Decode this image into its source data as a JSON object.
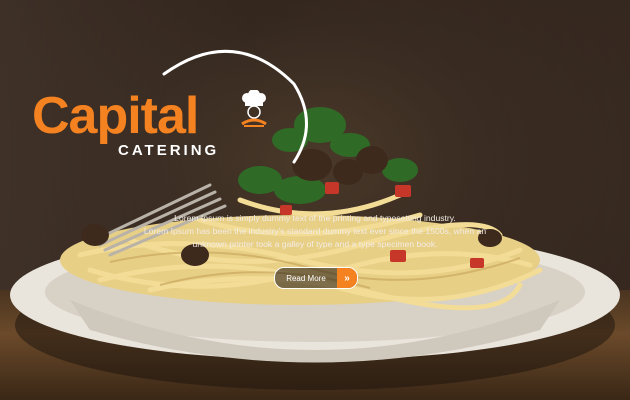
{
  "brand": {
    "name": "Capital",
    "sub": "CATERING",
    "accent": "#f58220",
    "chef_icon": "chef-hat-icon"
  },
  "hero": {
    "tagline_1": "Lorem Ipsum is simply dummy text of the printing and typesetting industry.",
    "tagline_2": "Lorem Ipsum has been the industry's standard dummy text ever since the 1500s, when an",
    "tagline_3": "unknown printer took a galley of type and a type specimen book.",
    "cta_label": "Read More",
    "cta_icon": "double-chevron-right-icon"
  }
}
